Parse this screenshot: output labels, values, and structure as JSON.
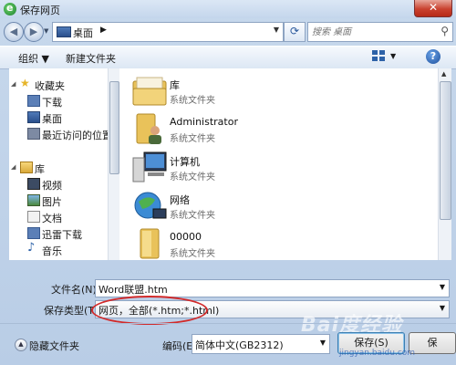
{
  "window": {
    "title": "保存网页",
    "app_icon_letter": "e",
    "close_glyph": "✕"
  },
  "navbar": {
    "back_glyph": "◀",
    "forward_glyph": "▶",
    "address": "桌面",
    "address_arrow": "▶",
    "refresh_glyph": "⟳",
    "search_placeholder": "搜索 桌面"
  },
  "toolbar": {
    "organize": "组织 ▼",
    "new_folder": "新建文件夹",
    "help": "?"
  },
  "sidebar": {
    "items": [
      {
        "label": "收藏夹",
        "icon": "star-icon",
        "level": 0
      },
      {
        "label": "下载",
        "icon": "download-folder-icon",
        "level": 1
      },
      {
        "label": "桌面",
        "icon": "desktop-icon",
        "level": 1
      },
      {
        "label": "最近访问的位置",
        "icon": "recent-places-icon",
        "level": 1
      },
      {
        "label": "库",
        "icon": "library-icon",
        "level": 0
      },
      {
        "label": "视频",
        "icon": "video-icon",
        "level": 1
      },
      {
        "label": "图片",
        "icon": "picture-icon",
        "level": 1
      },
      {
        "label": "文档",
        "icon": "document-icon",
        "level": 1
      },
      {
        "label": "迅雷下载",
        "icon": "thunder-download-icon",
        "level": 1
      },
      {
        "label": "音乐",
        "icon": "music-icon",
        "level": 1
      }
    ]
  },
  "files": [
    {
      "name": "库",
      "type": "系统文件夹",
      "icon": "library-folder-icon"
    },
    {
      "name": "Administrator",
      "type": "系统文件夹",
      "icon": "user-folder-icon"
    },
    {
      "name": "计算机",
      "type": "系统文件夹",
      "icon": "computer-icon"
    },
    {
      "name": "网络",
      "type": "系统文件夹",
      "icon": "network-icon"
    },
    {
      "name": "00000",
      "type": "系统文件夹",
      "icon": "folder-icon"
    }
  ],
  "form": {
    "filename_label": "文件名(N):",
    "filename_value": "Word联盟.htm",
    "filetype_label": "保存类型(T):",
    "filetype_value": "网页，全部(*.htm;*.html)",
    "dropdown_glyph": "▼"
  },
  "footer": {
    "hide_folders": "隐藏文件夹",
    "encoding_label": "编码(E):",
    "encoding_value": "简体中文(GB2312)",
    "save": "保存(S)",
    "cancel": "保"
  },
  "watermark": {
    "text": "Bai度经验",
    "sub": "jingyan.baidu.com"
  },
  "colors": {
    "accent": "#2d62a8",
    "highlight_oval": "#d22a2a",
    "folder_yellow": "#e9c25a"
  }
}
